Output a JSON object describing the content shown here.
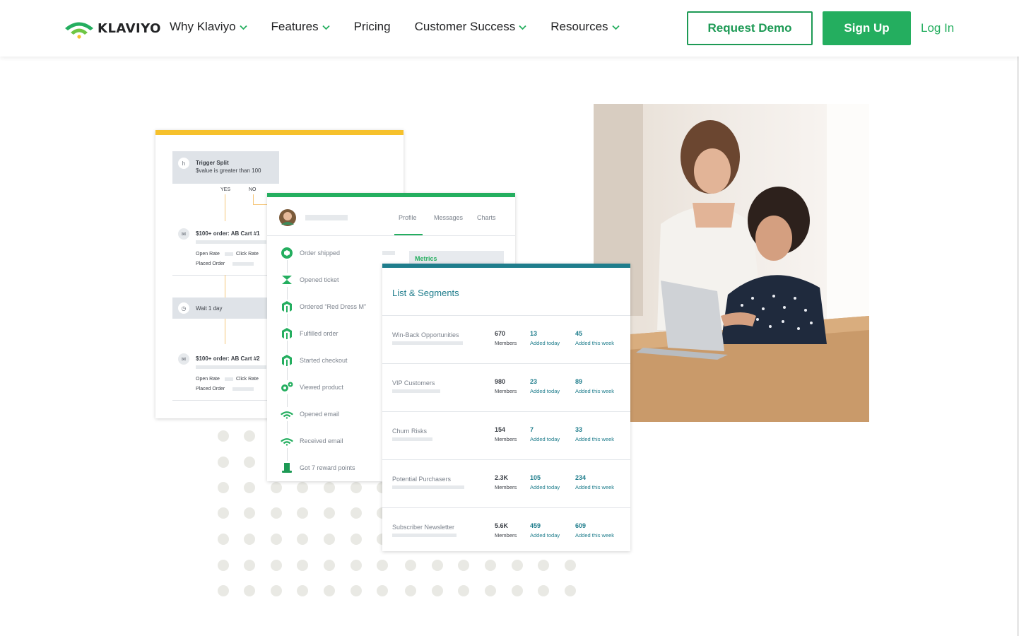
{
  "nav": {
    "logo_text": "KLAVIYO",
    "menu": [
      {
        "label": "Why Klaviyo",
        "has_dropdown": true
      },
      {
        "label": "Features",
        "has_dropdown": true
      },
      {
        "label": "Pricing",
        "has_dropdown": false
      },
      {
        "label": "Customer Success",
        "has_dropdown": true
      },
      {
        "label": "Resources",
        "has_dropdown": true
      }
    ],
    "request_demo": "Request Demo",
    "sign_up": "Sign Up",
    "log_in": "Log In"
  },
  "flow_card": {
    "trigger_title": "Trigger Split",
    "trigger_cond": "$value is greater than 100",
    "yes": "YES",
    "no": "NO",
    "email1_title": "$100+ order: AB Cart #1",
    "email2_title": "$100+ order: AB Cart #2",
    "open_rate": "Open Rate",
    "click_rate": "Click Rate",
    "placed_order": "Placed Order",
    "wait": "Wait 1 day"
  },
  "profile_card": {
    "tabs": [
      "Profile",
      "Messages",
      "Charts"
    ],
    "metrics_label": "Metrics",
    "events": [
      {
        "label": "Order shipped",
        "icon": "shipping-icon"
      },
      {
        "label": "Opened ticket",
        "icon": "zendesk-icon"
      },
      {
        "label": "Ordered “Red Dress M”",
        "icon": "magento-icon"
      },
      {
        "label": "Fulfilled order",
        "icon": "magento-icon"
      },
      {
        "label": "Started checkout",
        "icon": "magento-icon"
      },
      {
        "label": "Viewed product",
        "icon": "gears-icon"
      },
      {
        "label": "Opened email",
        "icon": "klaviyo-icon"
      },
      {
        "label": "Received email",
        "icon": "klaviyo-icon"
      },
      {
        "label": "Got 7 reward points",
        "icon": "top-hat-icon"
      }
    ]
  },
  "lists_card": {
    "title": "List & Segments",
    "members_label": "Members",
    "added_today_label": "Added today",
    "added_week_label": "Added this week",
    "rows": [
      {
        "name": "Win-Back Opportunities",
        "members": "670",
        "today": "13",
        "week": "45"
      },
      {
        "name": "VIP Customers",
        "members": "980",
        "today": "23",
        "week": "89"
      },
      {
        "name": "Churn Risks",
        "members": "154",
        "today": "7",
        "week": "33"
      },
      {
        "name": "Potential Purchasers",
        "members": "2.3K",
        "today": "105",
        "week": "234"
      },
      {
        "name": "Subscriber Newsletter",
        "members": "5.6K",
        "today": "459",
        "week": "609"
      }
    ]
  },
  "colors": {
    "brand_green": "#24ae5f",
    "teal": "#1f7d8c",
    "yellow": "#f6c12c"
  }
}
